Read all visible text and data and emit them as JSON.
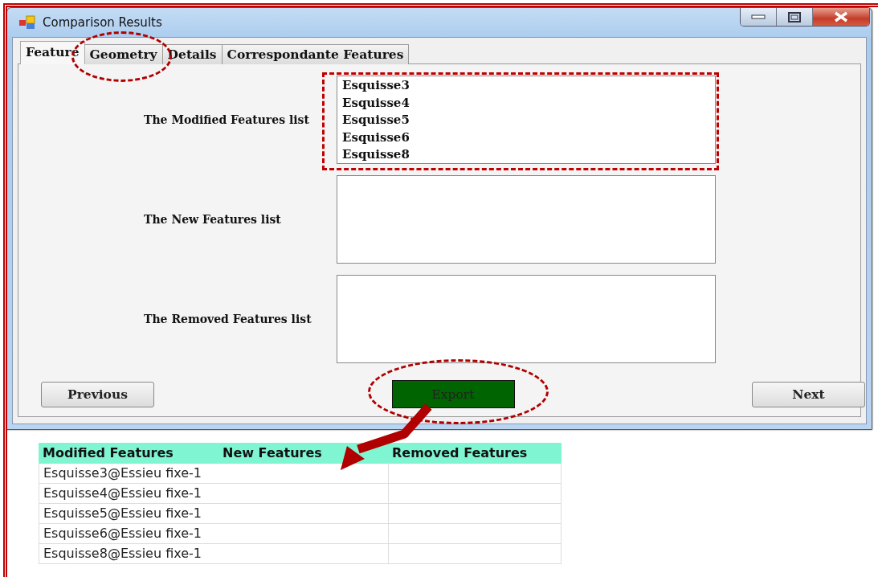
{
  "window": {
    "title": "Comparison Results"
  },
  "tabs": [
    {
      "label": "Feature",
      "selected": true,
      "highlighted": false
    },
    {
      "label": "Geometry",
      "selected": false,
      "highlighted": true
    },
    {
      "label": "Details",
      "selected": false,
      "highlighted": false
    },
    {
      "label": "Correspondante Features",
      "selected": false,
      "highlighted": false
    }
  ],
  "lists": [
    {
      "label": "The Modified Features list",
      "highlighted": true,
      "items": [
        "Esquisse3",
        "Esquisse4",
        "Esquisse5",
        "Esquisse6",
        "Esquisse8"
      ]
    },
    {
      "label": "The New Features list",
      "highlighted": false
    },
    {
      "label": "The Removed Features list",
      "highlighted": false
    }
  ],
  "buttons": [
    {
      "kind": "plain",
      "label": "Previous",
      "highlighted": false
    },
    {
      "kind": "export",
      "label": "Export",
      "highlighted": true
    },
    {
      "kind": "plain",
      "label": "Next",
      "highlighted": false
    }
  ],
  "spreadsheet": {
    "columns": [
      "Modified Features",
      "New Features",
      "Removed Features"
    ],
    "rows": [
      [
        "Esquisse3@Essieu fixe-1"
      ],
      [
        "Esquisse4@Essieu fixe-1"
      ],
      [
        "Esquisse5@Essieu fixe-1"
      ],
      [
        "Esquisse6@Essieu fixe-1"
      ],
      [
        "Esquisse8@Essieu fixe-1"
      ]
    ]
  }
}
